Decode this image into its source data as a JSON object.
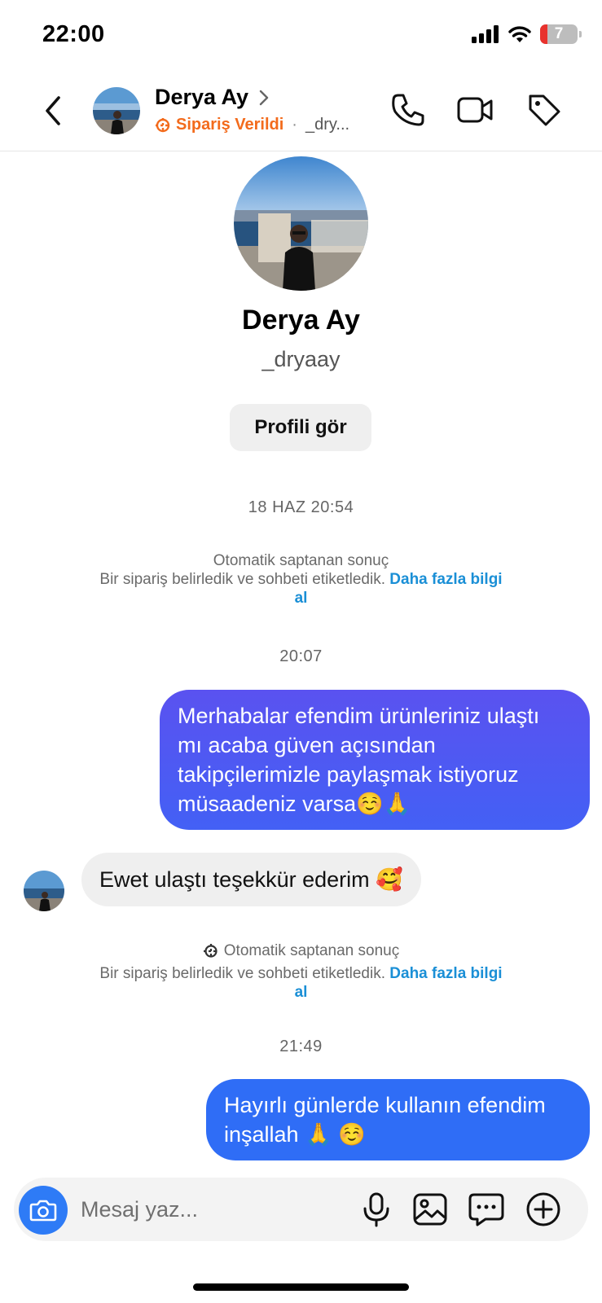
{
  "status_bar": {
    "time": "22:00",
    "battery_level": "7"
  },
  "header": {
    "name": "Derya Ay",
    "order_status": "Sipariş Verildi",
    "username_short": "_dry..."
  },
  "profile": {
    "name": "Derya Ay",
    "username": "_dryaay",
    "view_profile_label": "Profili gör"
  },
  "chat": {
    "timestamp_1": "18 HAZ 20:54",
    "system_note_1": {
      "title": "Otomatik saptanan sonuç",
      "text": "Bir sipariş belirledik ve sohbeti etiketledik.",
      "link_part1": "Daha fazla bilgi",
      "link_part2": "al"
    },
    "timestamp_2": "20:07",
    "message_out_1": {
      "line1": "Merhabalar efendim ürünleriniz ulaştı",
      "line2": "mı acaba güven açısından",
      "line3": "takipçilerimizle paylaşmak istiyoruz",
      "line4": "müsaadeniz varsa☺️🙏"
    },
    "message_in_1": {
      "text": "Ewet ulaştı teşekkür ederim 🥰"
    },
    "system_note_2": {
      "title": "Otomatik saptanan sonuç",
      "text": "Bir sipariş belirledik ve sohbeti etiketledik.",
      "link_part1": "Daha fazla bilgi",
      "link_part2": "al"
    },
    "timestamp_3": "21:49",
    "message_out_2": {
      "line1": "Hayırlı günlerde kullanın efendim",
      "line2": "inşallah 🙏 ☺️"
    }
  },
  "input": {
    "placeholder": "Mesaj yaz..."
  },
  "colors": {
    "bubble_gradient_top": "#4a5cf5",
    "bubble_solid": "#2f6df6",
    "order_accent": "#f36b1c",
    "link": "#1a8fd6",
    "camera_button": "#2e7bf6"
  },
  "icons": [
    "back-icon",
    "chevron-right-icon",
    "order-icon",
    "phone-icon",
    "video-icon",
    "tag-icon",
    "camera-icon",
    "microphone-icon",
    "gallery-icon",
    "sticker-icon",
    "plus-icon",
    "signal-icon",
    "wifi-icon",
    "battery-icon"
  ]
}
